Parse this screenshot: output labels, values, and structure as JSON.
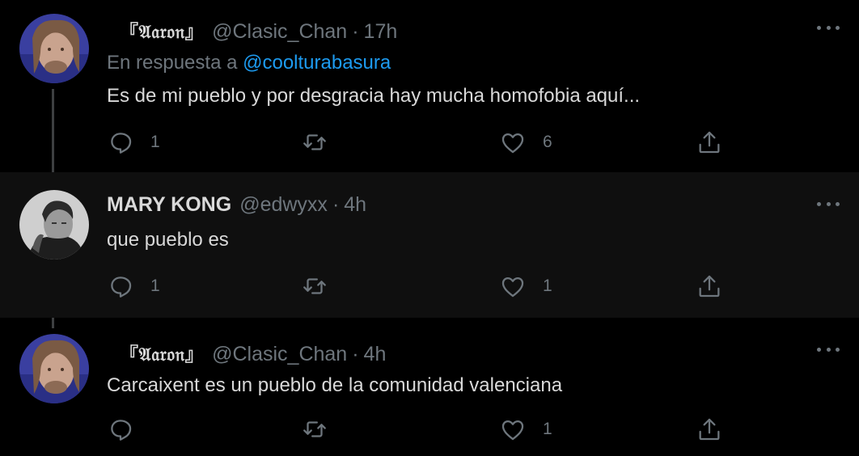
{
  "tweets": [
    {
      "name": "『𝔄𝔞𝔯𝔬𝔫』",
      "handle": "@Clasic_Chan",
      "separator": "·",
      "time": "17h",
      "reply_prefix": "En respuesta a",
      "reply_mention": "@coolturabasura",
      "text": "Es de mi pueblo y por desgracia hay mucha homofobia aquí...",
      "replies": "1",
      "retweets": "",
      "likes": "6"
    },
    {
      "name": "MARY KONG",
      "handle": "@edwyxx",
      "separator": "·",
      "time": "4h",
      "text": "que pueblo es",
      "replies": "1",
      "retweets": "",
      "likes": "1"
    },
    {
      "name": "『𝔄𝔞𝔯𝔬𝔫』",
      "handle": "@Clasic_Chan",
      "separator": "·",
      "time": "4h",
      "text": "Carcaixent es un pueblo de la comunidad valenciana",
      "replies": "",
      "retweets": "",
      "likes": "1"
    }
  ],
  "icons": {
    "reply": "reply-icon",
    "retweet": "retweet-icon",
    "like": "heart-icon",
    "share": "share-icon",
    "more": "more-icon"
  },
  "colors": {
    "background": "#000000",
    "highlight_background": "#0f0f0f",
    "text": "#d9d9d9",
    "secondary": "#6e767d",
    "link": "#1d9bf0",
    "thread_line": "#3d3f41"
  }
}
